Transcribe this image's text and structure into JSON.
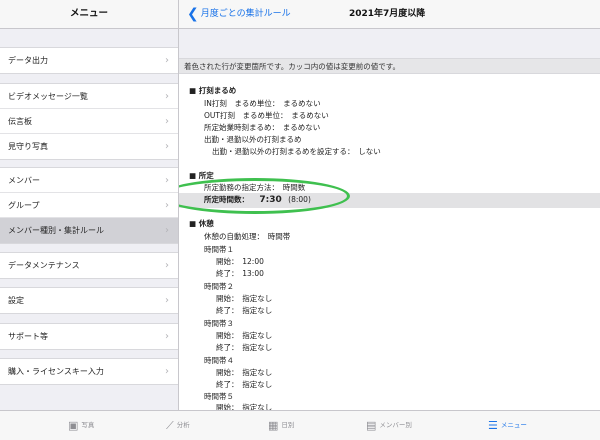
{
  "sidebar": {
    "title": "メニュー",
    "items": [
      "データ出力",
      "ビデオメッセージ一覧",
      "伝言板",
      "見守り写真",
      "メンバー",
      "グループ",
      "メンバー種別・集計ルール",
      "データメンテナンス",
      "設定",
      "サポート等",
      "購入・ライセンスキー入力"
    ]
  },
  "header": {
    "back_label": "月度ごとの集計ルール",
    "title": "2021年7月度以降"
  },
  "notice": "着色された行が変更箇所です。カッコ内の値は変更前の値です。",
  "rounding": {
    "title": "打刻まるめ",
    "in_line": "IN打刻　まるめ単位：　まるめない",
    "out_line": "OUT打刻　まるめ単位：　まるめない",
    "start_line": "所定始業時刻まるめ：　まるめない",
    "other_title": "出勤・退勤以外の打刻まるめ",
    "other_line": "出勤・退勤以外の打刻まるめを設定する：　しない"
  },
  "scheduled": {
    "title": "所定",
    "method_line": "所定勤務の指定方法：　時間数",
    "hours_label": "所定時間数：",
    "hours_value": "7:30",
    "hours_prev": "(8:00)"
  },
  "breaks": {
    "title": "休憩",
    "auto_line": "休憩の自動処理：　時間帯",
    "slot1": "時間帯１",
    "slot1_start": "開始：　12:00",
    "slot1_end": "終了：　13:00",
    "slot2": "時間帯２",
    "slot2_start": "開始：　指定なし",
    "slot2_end": "終了：　指定なし",
    "slot3": "時間帯３",
    "slot3_start": "開始：　指定なし",
    "slot3_end": "終了：　指定なし",
    "slot4": "時間帯４",
    "slot4_start": "開始：　指定なし",
    "slot4_end": "終了：　指定なし",
    "slot5": "時間帯５",
    "slot5_start": "開始：　指定なし"
  },
  "tabs": {
    "photo": "写真",
    "analysis": "分析",
    "daily": "日別",
    "member": "メンバー別",
    "menu": "メニュー"
  },
  "colors": {
    "accent": "#1a73e8",
    "highlight_circle": "#3fc04f"
  }
}
